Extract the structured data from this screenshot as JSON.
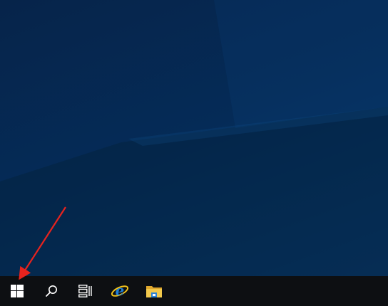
{
  "desktop": {
    "background": "windows-10-blue-hero"
  },
  "taskbar": {
    "items": [
      {
        "name": "start-button",
        "icon": "windows-logo-icon"
      },
      {
        "name": "search-button",
        "icon": "search-icon"
      },
      {
        "name": "task-view-button",
        "icon": "task-view-icon"
      },
      {
        "name": "internet-explorer-button",
        "icon": "internet-explorer-icon"
      },
      {
        "name": "file-explorer-button",
        "icon": "file-explorer-icon"
      }
    ]
  },
  "annotation": {
    "type": "arrow",
    "color": "#e8231e",
    "target": "start-button"
  },
  "colors": {
    "taskbar": "#0d0f12",
    "icon": "#ffffff",
    "ie_blue": "#1e7fd8",
    "ie_ring": "#f2c21b",
    "folder_yellow": "#f2c94c",
    "folder_blue": "#2b83d6"
  }
}
